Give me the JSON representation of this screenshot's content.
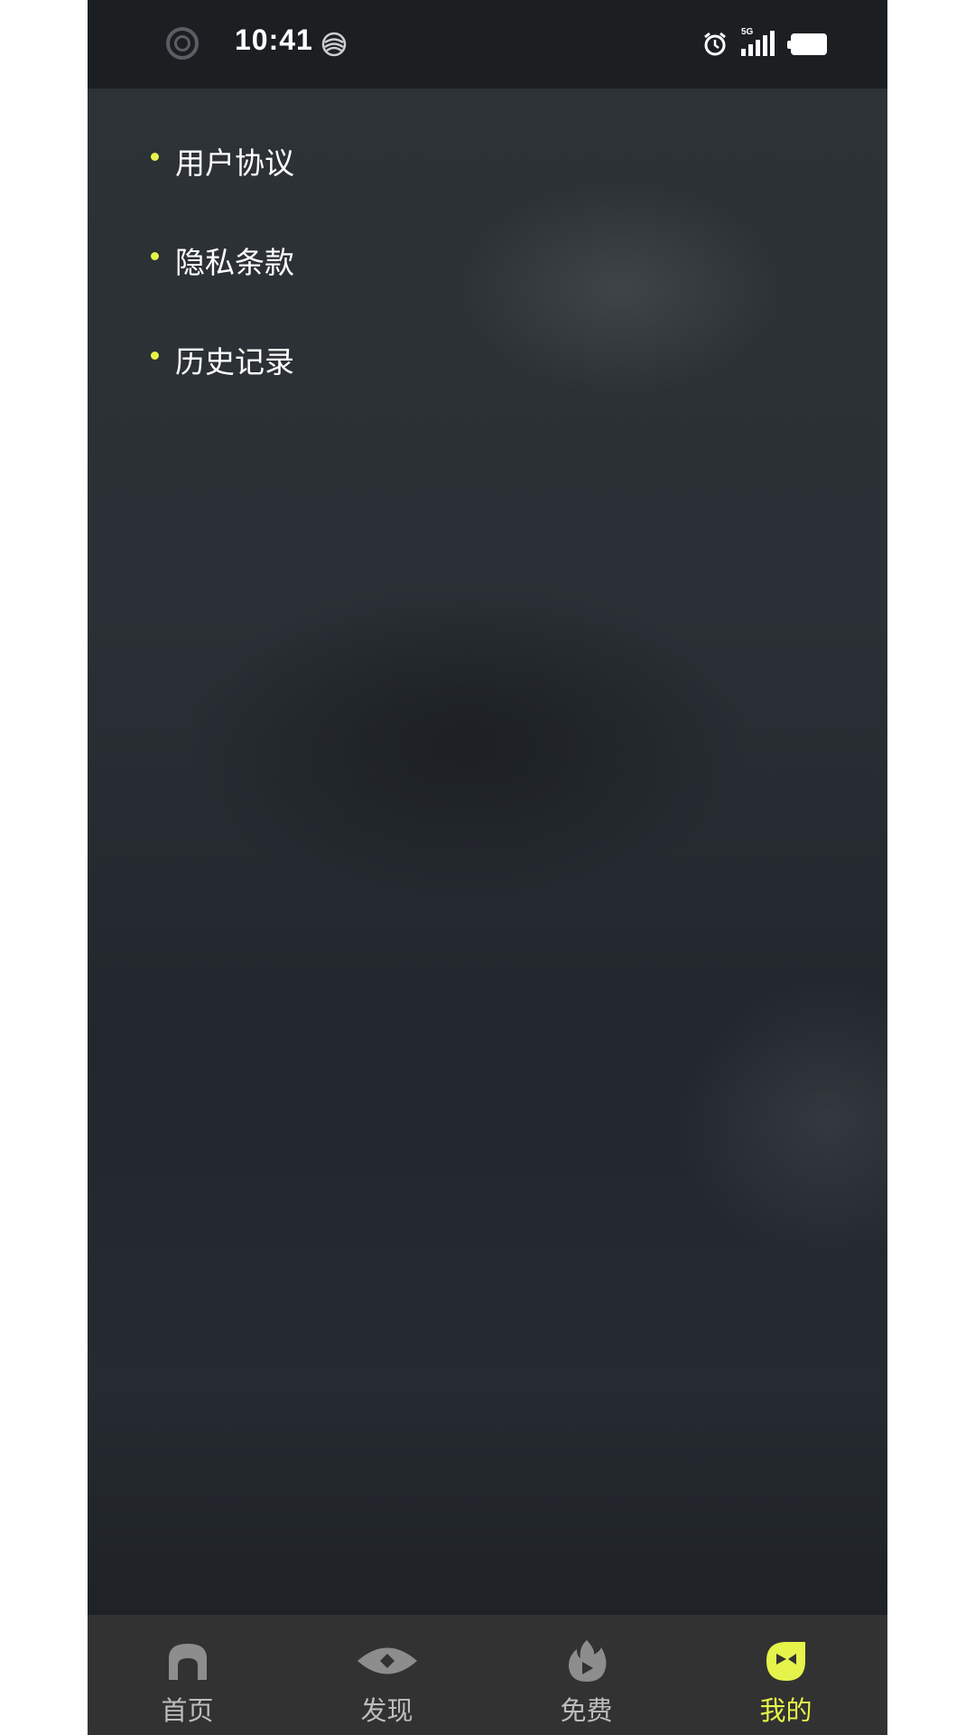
{
  "status_bar": {
    "time": "10:41",
    "network": "5G",
    "icons": [
      "ring-indicator-icon",
      "carrier-logo-icon",
      "alarm-icon",
      "signal-5g-icon",
      "battery-icon"
    ]
  },
  "menu": {
    "items": [
      {
        "label": "用户协议"
      },
      {
        "label": "隐私条款"
      },
      {
        "label": "历史记录"
      }
    ]
  },
  "tabs": [
    {
      "label": "首页",
      "icon": "home-icon",
      "active": false
    },
    {
      "label": "发现",
      "icon": "eye-icon",
      "active": false
    },
    {
      "label": "免费",
      "icon": "flame-play-icon",
      "active": false
    },
    {
      "label": "我的",
      "icon": "profile-face-icon",
      "active": true
    }
  ],
  "colors": {
    "accent": "#e6f34a",
    "tab_bar_bg": "#323232",
    "status_bar_bg": "#1c1f22",
    "inactive_tab": "#bdbdbd"
  }
}
